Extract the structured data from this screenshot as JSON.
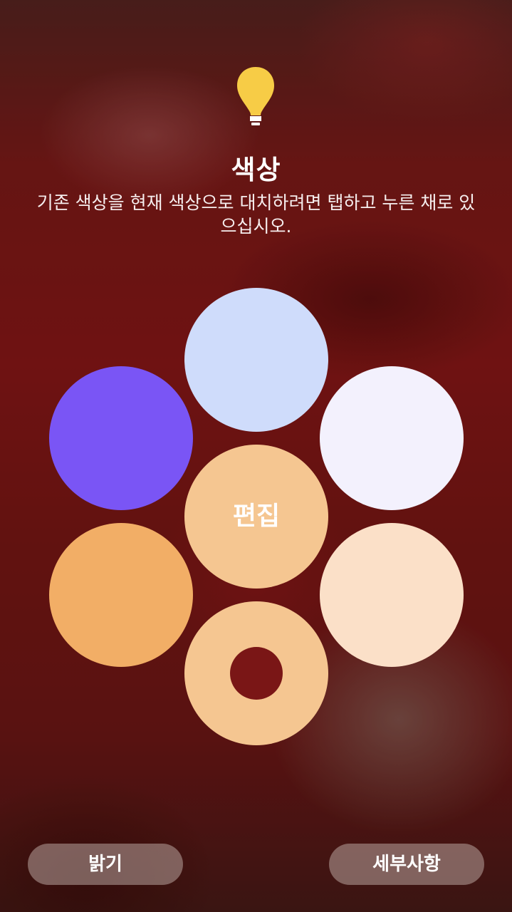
{
  "header": {
    "icon": "lightbulb-icon",
    "title": "색상",
    "description": "기존 색상을 현재 색상으로 대치하려면 탭하고 누른 채로 있으십시오."
  },
  "palette": {
    "edit_label": "편집",
    "swatches": [
      {
        "name": "light-blue",
        "color": "#cfdcfb"
      },
      {
        "name": "purple",
        "color": "#7a55f5"
      },
      {
        "name": "lavender-white",
        "color": "#f3f1fd"
      },
      {
        "name": "orange",
        "color": "#f2ae66"
      },
      {
        "name": "peach-light",
        "color": "#fbe0c8"
      },
      {
        "name": "center-peach",
        "color": "#f5c691"
      },
      {
        "name": "current-ring",
        "color": "#f5c691"
      }
    ]
  },
  "buttons": {
    "brightness_label": "밝기",
    "details_label": "세부사항"
  },
  "colors": {
    "bulb": "#f7cc46",
    "button_bg": "rgba(190,170,165,0.52)"
  }
}
